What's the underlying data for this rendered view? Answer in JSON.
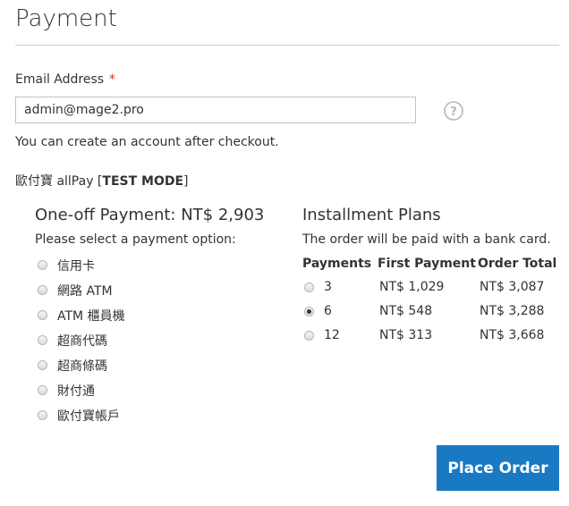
{
  "page": {
    "title": "Payment"
  },
  "email": {
    "label": "Email Address",
    "required_marker": "*",
    "value": "admin@mage2.pro",
    "help_icon": "question-circle-icon",
    "note": "You can create an account after checkout."
  },
  "method": {
    "name": "歐付寶 allPay [",
    "mode": "TEST MODE",
    "close": "]"
  },
  "one_off": {
    "heading": "One-off Payment: NT$ 2,903",
    "prompt": "Please select a payment option:",
    "options": [
      {
        "label": "信用卡"
      },
      {
        "label": "網路 ATM"
      },
      {
        "label": "ATM 櫃員機"
      },
      {
        "label": "超商代碼"
      },
      {
        "label": "超商條碼"
      },
      {
        "label": "財付通"
      },
      {
        "label": "歐付寶帳戶"
      }
    ]
  },
  "installments": {
    "heading": "Installment Plans",
    "prompt": "The order will be paid with a bank card.",
    "columns": [
      "Payments",
      "First Payment",
      "Order Total"
    ],
    "rows": [
      {
        "payments": "3",
        "first": "NT$ 1,029",
        "total": "NT$ 3,087",
        "selected": false
      },
      {
        "payments": "6",
        "first": "NT$ 548",
        "total": "NT$ 3,288",
        "selected": true
      },
      {
        "payments": "12",
        "first": "NT$ 313",
        "total": "NT$ 3,668",
        "selected": false
      }
    ]
  },
  "actions": {
    "place_order": "Place Order"
  },
  "colors": {
    "accent": "#1979c3",
    "required": "#e02b27"
  }
}
